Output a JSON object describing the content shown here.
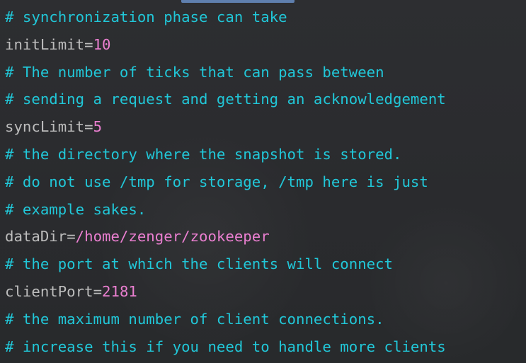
{
  "colors": {
    "background": "#2b2b2b",
    "comment": "#21c7d8",
    "key": "#bdbdbd",
    "value": "#ea7fd0",
    "scrollbar": "#5f7fae"
  },
  "lines": [
    {
      "type": "comment",
      "text": "# synchronization phase can take"
    },
    {
      "type": "prop",
      "key": "initLimit",
      "eq": "=",
      "value": "10"
    },
    {
      "type": "comment",
      "text": "# The number of ticks that can pass between"
    },
    {
      "type": "comment",
      "text": "# sending a request and getting an acknowledgement"
    },
    {
      "type": "prop",
      "key": "syncLimit",
      "eq": "=",
      "value": "5"
    },
    {
      "type": "comment",
      "text": "# the directory where the snapshot is stored."
    },
    {
      "type": "comment",
      "text": "# do not use /tmp for storage, /tmp here is just"
    },
    {
      "type": "comment",
      "text": "# example sakes."
    },
    {
      "type": "prop",
      "key": "dataDir",
      "eq": "=",
      "value": "/home/zenger/zookeeper"
    },
    {
      "type": "comment",
      "text": "# the port at which the clients will connect"
    },
    {
      "type": "prop",
      "key": "clientPort",
      "eq": "=",
      "value": "2181"
    },
    {
      "type": "comment",
      "text": "# the maximum number of client connections."
    },
    {
      "type": "comment",
      "text": "# increase this if you need to handle more clients"
    }
  ]
}
